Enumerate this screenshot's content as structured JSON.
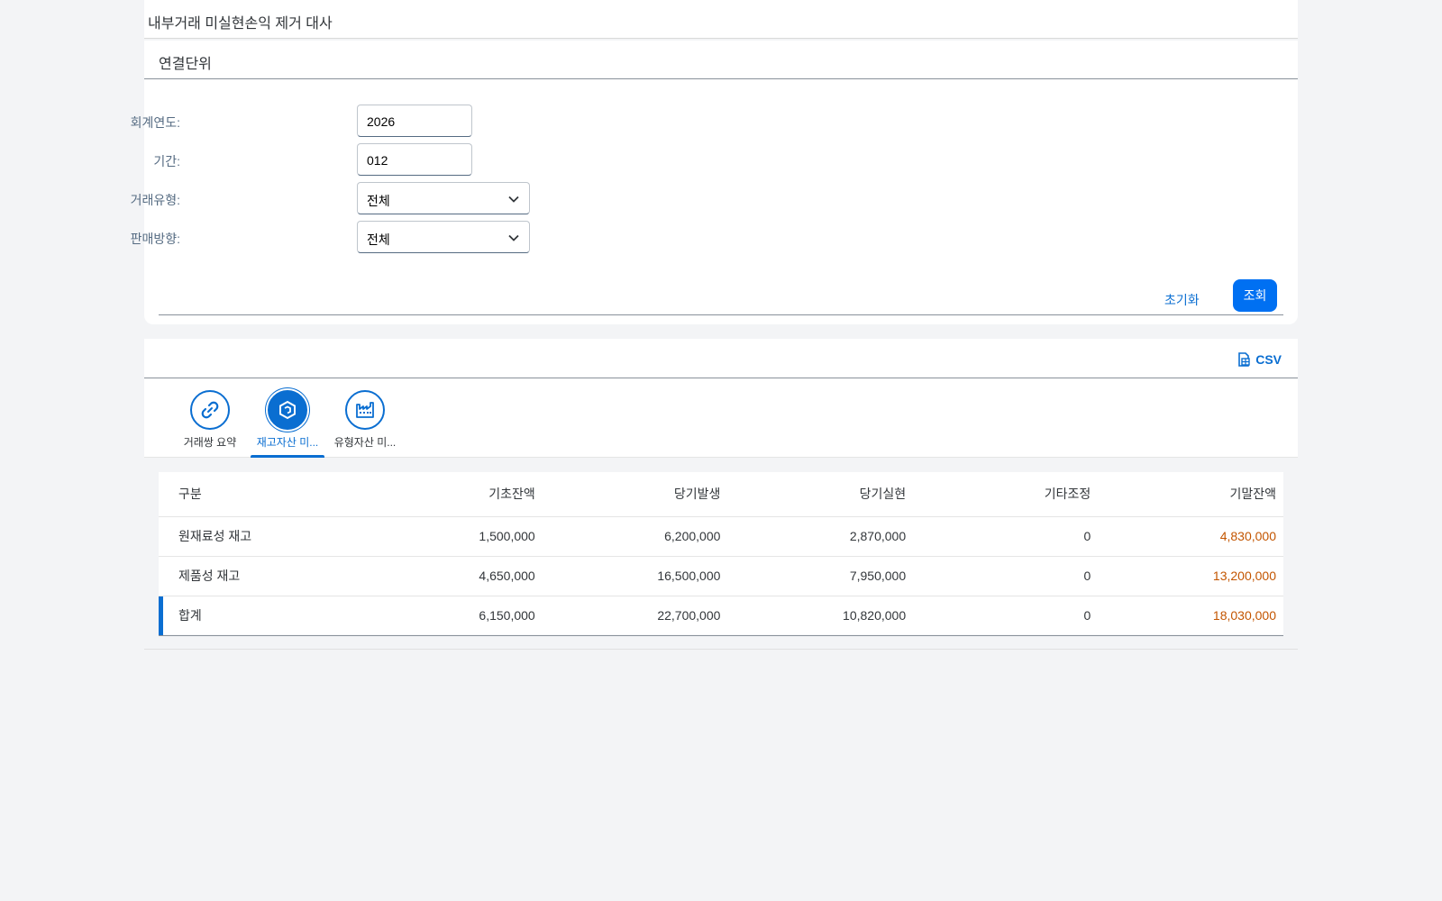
{
  "app": {
    "title": "내부거래 미실현손익 제거 대사"
  },
  "filter": {
    "title": "연결단위",
    "fields": [
      {
        "label": "회계연도:",
        "value": "2026",
        "type": "text"
      },
      {
        "label": "기간:",
        "value": "012",
        "type": "text"
      },
      {
        "label": "거래유형:",
        "value": "전체",
        "type": "select"
      },
      {
        "label": "판매방향:",
        "value": "전체",
        "type": "select"
      }
    ],
    "reset_label": "초기화",
    "search_label": "조회"
  },
  "toolbar": {
    "csv_label": "CSV",
    "csv_icon": "export-spreadsheet-icon"
  },
  "tabs": [
    {
      "label": "거래쌍 요약",
      "icon": "link-icon",
      "active": false
    },
    {
      "label": "재고자산 미...",
      "icon": "product-box-icon",
      "active": true
    },
    {
      "label": "유형자산 미...",
      "icon": "factory-icon",
      "active": false
    }
  ],
  "table": {
    "columns": [
      "구분",
      "기초잔액",
      "당기발생",
      "당기실현",
      "기타조정",
      "기말잔액"
    ],
    "rows": [
      {
        "name": "원재료성 재고",
        "opening": "1,500,000",
        "incurred": "6,200,000",
        "realized": "2,870,000",
        "other": "0",
        "ending": "4,830,000"
      },
      {
        "name": "제품성 재고",
        "opening": "4,650,000",
        "incurred": "16,500,000",
        "realized": "7,950,000",
        "other": "0",
        "ending": "13,200,000"
      },
      {
        "name": "합계",
        "opening": "6,150,000",
        "incurred": "22,700,000",
        "realized": "10,820,000",
        "other": "0",
        "ending": "18,030,000"
      }
    ]
  },
  "colors": {
    "accent": "#0a6ed1",
    "primary_button": "#0070f2",
    "ending_balance": "#c35500"
  }
}
